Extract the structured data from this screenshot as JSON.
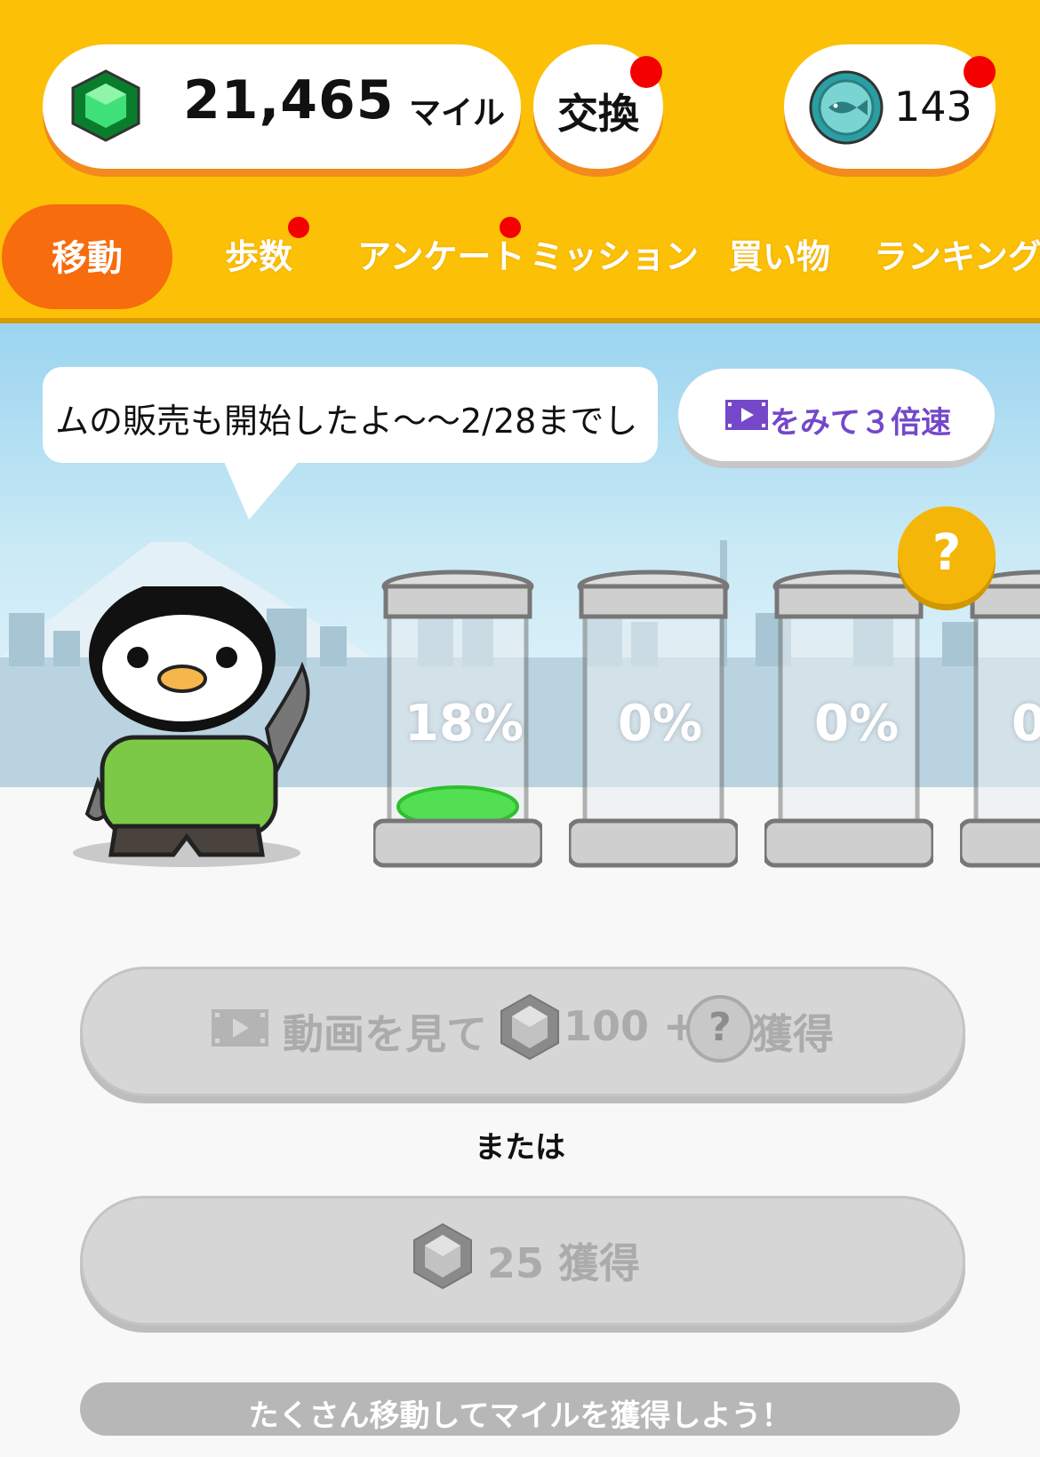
{
  "header": {
    "miles": {
      "value": "21,465",
      "unit": "マイル",
      "icon": "green-gem-icon"
    },
    "exchange": {
      "label": "交換",
      "has_notification": true
    },
    "fish_coin": {
      "value": "143",
      "icon": "fish-coin-icon",
      "has_notification": true
    }
  },
  "tabs": [
    {
      "label": "移動",
      "active": true
    },
    {
      "label": "歩数",
      "has_notification": true
    },
    {
      "label": "アンケート",
      "has_notification": true
    },
    {
      "label": "ミッション"
    },
    {
      "label": "買い物"
    },
    {
      "label": "ランキング"
    }
  ],
  "scene": {
    "speech_text": "ムの販売も開始したよ〜〜2/28までし",
    "video_boost_label": "をみて３倍速",
    "jars": [
      {
        "label": "18%",
        "fill_percent": 18
      },
      {
        "label": "0%",
        "fill_percent": 0
      },
      {
        "label": "0%",
        "fill_percent": 0
      },
      {
        "label": "0",
        "fill_percent": 0
      }
    ],
    "question_badge": "?"
  },
  "actions": {
    "video_reward": {
      "part1": "動画を見て",
      "amount": "100 +",
      "part2": "獲得",
      "question": "?"
    },
    "or_label": "または",
    "basic_reward": {
      "label": "25 獲得"
    }
  },
  "footer": {
    "message": "たくさん移動してマイルを獲得しよう！"
  },
  "colors": {
    "header": "#fcc107",
    "active_tab": "#f76c0c",
    "notification": "#f50000",
    "accent_purple": "#7448c9"
  }
}
